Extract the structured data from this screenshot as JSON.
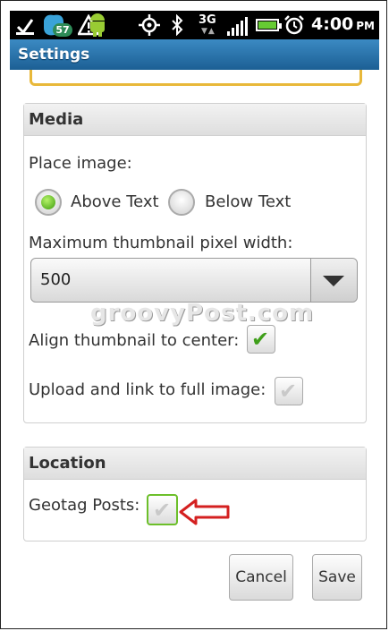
{
  "status_bar": {
    "notification_count": "57",
    "network": "3G",
    "time": "4:00",
    "time_suffix": "PM",
    "icons": [
      "sd-card-icon",
      "warning-icon",
      "android-icon",
      "gps-icon",
      "bluetooth-icon",
      "signal-icon",
      "battery-icon",
      "alarm-icon"
    ]
  },
  "titlebar": {
    "title": "Settings"
  },
  "media": {
    "header": "Media",
    "place_image_label": "Place image:",
    "radio_above": "Above Text",
    "radio_below": "Below Text",
    "selected": "above",
    "thumb_width_label": "Maximum thumbnail pixel width:",
    "thumb_width_value": "500",
    "align_center_label": "Align thumbnail to center:",
    "align_center_checked": true,
    "upload_full_label": "Upload and link to full image:",
    "upload_full_checked": false
  },
  "watermark": "groovyPost.com",
  "location": {
    "header": "Location",
    "geotag_label": "Geotag Posts:",
    "geotag_checked": false
  },
  "buttons": {
    "cancel": "Cancel",
    "save": "Save"
  },
  "colors": {
    "titlebar": "#2a73ad",
    "check_on": "#3f9f1a",
    "annotation_arrow": "#d42020",
    "focus_outline": "#6cbf2a"
  }
}
